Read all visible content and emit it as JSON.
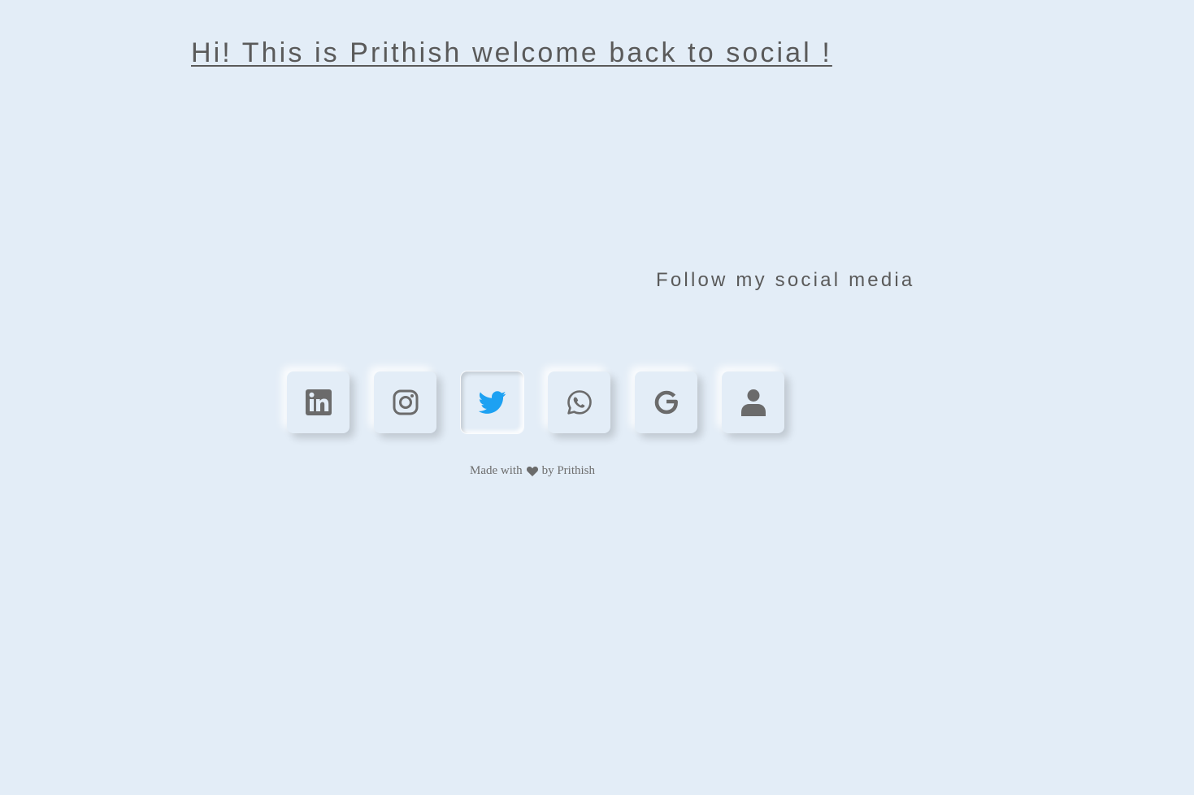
{
  "page": {
    "headline": "Hi! This is Prithish welcome back to social !",
    "follow_text": "Follow my social media"
  },
  "social": [
    {
      "name": "linkedin",
      "icon": "linkedin-icon",
      "state": "default"
    },
    {
      "name": "instagram",
      "icon": "instagram-icon",
      "state": "default"
    },
    {
      "name": "twitter",
      "icon": "twitter-icon",
      "state": "pressed"
    },
    {
      "name": "whatsapp",
      "icon": "whatsapp-icon",
      "state": "default"
    },
    {
      "name": "google",
      "icon": "google-icon",
      "state": "default"
    },
    {
      "name": "profile",
      "icon": "user-icon",
      "state": "default"
    }
  ],
  "footer": {
    "made_with": "Made with",
    "heart_icon": "heart-icon",
    "by": "by Prithish"
  },
  "colors": {
    "background": "#e3edf7",
    "text": "#5a5a5a",
    "icon": "#6b6b6b",
    "twitter_accent": "#1da1f2"
  }
}
